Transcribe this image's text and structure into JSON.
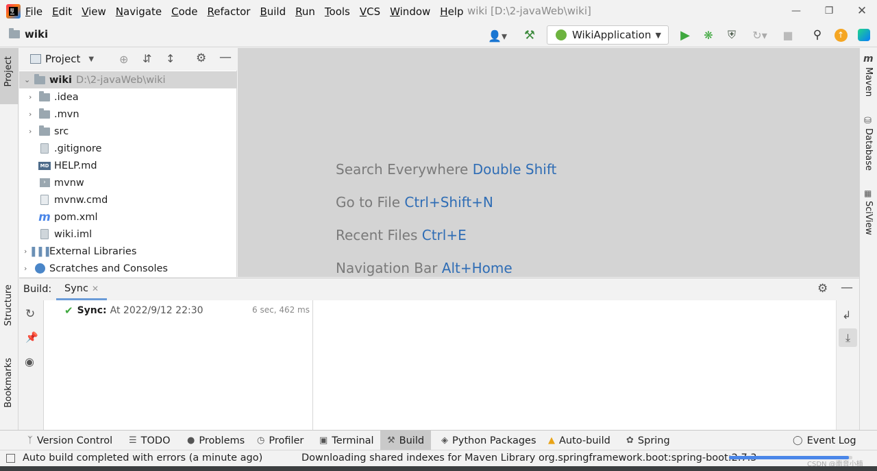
{
  "titlebar": {
    "menu": [
      {
        "label": "File",
        "u": "F",
        "rest": "ile"
      },
      {
        "label": "Edit",
        "u": "E",
        "rest": "dit"
      },
      {
        "label": "View",
        "u": "V",
        "rest": "iew"
      },
      {
        "label": "Navigate",
        "u": "N",
        "rest": "avigate"
      },
      {
        "label": "Code",
        "u": "C",
        "rest": "ode"
      },
      {
        "label": "Refactor",
        "u": "R",
        "rest": "efactor"
      },
      {
        "label": "Build",
        "u": "B",
        "rest": "uild"
      },
      {
        "label": "Run",
        "u": "R",
        "rest": "un"
      },
      {
        "label": "Tools",
        "u": "T",
        "rest": "ools"
      },
      {
        "label": "VCS",
        "u": "V",
        "rest": "CS"
      },
      {
        "label": "Window",
        "u": "W",
        "rest": "indow"
      },
      {
        "label": "Help",
        "u": "H",
        "rest": "elp"
      }
    ],
    "window_title": "wiki [D:\\2-javaWeb\\wiki]"
  },
  "navbar": {
    "breadcrumb": "wiki",
    "run_config": "WikiApplication"
  },
  "left_strip": {
    "project": "Project",
    "structure": "Structure",
    "bookmarks": "Bookmarks"
  },
  "right_strip": {
    "maven": "Maven",
    "database": "Database",
    "sciview": "SciView"
  },
  "project_panel": {
    "title": "Project",
    "root": {
      "name": "wiki",
      "path": "D:\\2-javaWeb\\wiki"
    },
    "items": [
      {
        "name": ".idea",
        "kind": "folder"
      },
      {
        "name": ".mvn",
        "kind": "folder"
      },
      {
        "name": "src",
        "kind": "folder"
      },
      {
        "name": ".gitignore",
        "kind": "file"
      },
      {
        "name": "HELP.md",
        "kind": "md"
      },
      {
        "name": "mvnw",
        "kind": "script"
      },
      {
        "name": "mvnw.cmd",
        "kind": "text"
      },
      {
        "name": "pom.xml",
        "kind": "maven"
      },
      {
        "name": "wiki.iml",
        "kind": "iml"
      }
    ],
    "external": "External Libraries",
    "scratches": "Scratches and Consoles"
  },
  "editor_hints": [
    {
      "text": "Search Everywhere",
      "key": "Double Shift"
    },
    {
      "text": "Go to File",
      "key": "Ctrl+Shift+N"
    },
    {
      "text": "Recent Files",
      "key": "Ctrl+E"
    },
    {
      "text": "Navigation Bar",
      "key": "Alt+Home"
    }
  ],
  "build": {
    "label": "Build:",
    "tab": "Sync",
    "sync_title": "Sync:",
    "sync_time": "At 2022/9/12 22:30",
    "duration": "6 sec, 462 ms"
  },
  "toolwindows": {
    "version_control": "Version Control",
    "todo": "TODO",
    "problems": "Problems",
    "profiler": "Profiler",
    "terminal": "Terminal",
    "build": "Build",
    "python_packages": "Python Packages",
    "auto_build": "Auto-build",
    "spring": "Spring",
    "event_log": "Event Log"
  },
  "status": {
    "left": "Auto build completed with errors (a minute ago)",
    "center": "Downloading shared indexes for Maven Library org.springframework.boot:spring-boot:2.7.3",
    "progress": 0.97,
    "watermark": "CSDN @南音小楠"
  },
  "colors": {
    "accent": "#2f6db5",
    "run": "#3ea83e",
    "editor_bg": "#d4d4d4"
  }
}
